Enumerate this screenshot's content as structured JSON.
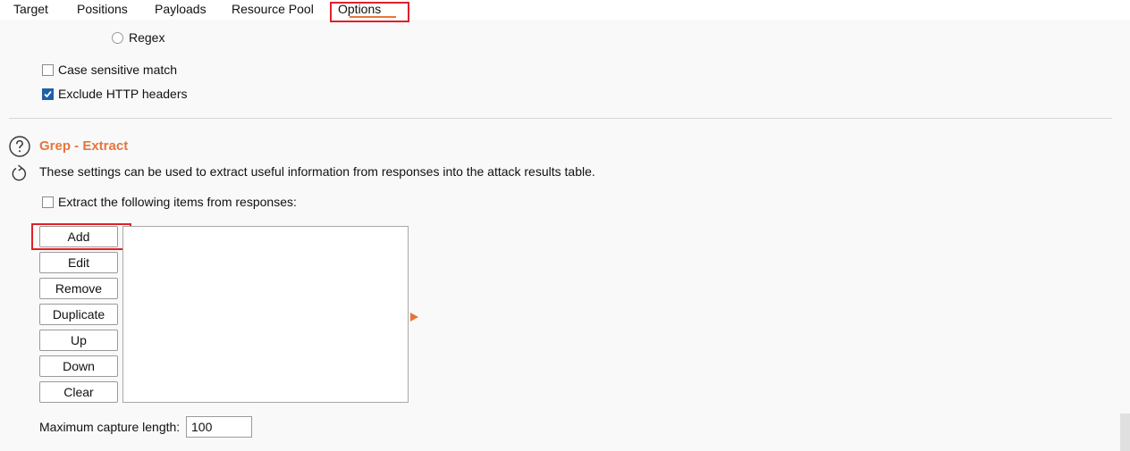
{
  "tabs": [
    {
      "label": "Target"
    },
    {
      "label": "Positions"
    },
    {
      "label": "Payloads"
    },
    {
      "label": "Resource Pool"
    },
    {
      "label": "Options",
      "active": true
    }
  ],
  "match_options": {
    "regex_label": "Regex",
    "case_sensitive_label": "Case sensitive match",
    "case_sensitive_checked": false,
    "exclude_headers_label": "Exclude HTTP headers",
    "exclude_headers_checked": true
  },
  "grep_extract": {
    "title": "Grep - Extract",
    "description": "These settings can be used to extract useful information from responses into the attack results table.",
    "extract_label": "Extract the following items from responses:",
    "extract_checked": false,
    "buttons": [
      "Add",
      "Edit",
      "Remove",
      "Duplicate",
      "Up",
      "Down",
      "Clear"
    ],
    "items": [],
    "max_capture_label": "Maximum capture length:",
    "max_capture_value": "100"
  },
  "colors": {
    "accent": "#e8743b",
    "highlight": "#e0202a",
    "checkbox_checked": "#1f5fa8"
  },
  "icons": {
    "help": "question-circle",
    "refresh": "circular-arrow",
    "expand": "triangle-right"
  }
}
